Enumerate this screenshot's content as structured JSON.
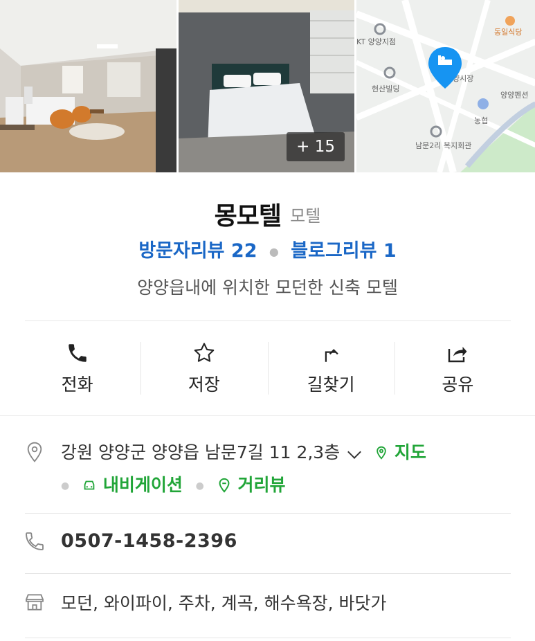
{
  "photos": {
    "more_count": "+ 15",
    "map_labels": [
      "KT 양양지점",
      "동일식당",
      "현산빌딩",
      "양시장",
      "양양펜션",
      "농협",
      "남문2리 복지회관"
    ]
  },
  "place": {
    "name": "몽모텔",
    "category": "모텔",
    "visitor_reviews": "방문자리뷰 22",
    "blog_reviews": "블로그리뷰 1",
    "description": "양양읍내에 위치한 모던한 신축 모텔"
  },
  "actions": [
    {
      "label": "전화",
      "icon": "phone-icon"
    },
    {
      "label": "저장",
      "icon": "star-icon"
    },
    {
      "label": "길찾기",
      "icon": "directions-icon"
    },
    {
      "label": "공유",
      "icon": "share-icon"
    }
  ],
  "address": {
    "text": "강원 양양군 양양읍 남문7길 11 2,3층",
    "map_link": "지도",
    "navigation_link": "내비게이션",
    "streetview_link": "거리뷰"
  },
  "phone": "0507-1458-2396",
  "amenities": "모던, 와이파이, 주차, 계곡, 해수욕장, 바닷가",
  "colors": {
    "blue": "#1a67c6",
    "green": "#21a538",
    "map_pin": "#1694f2"
  }
}
